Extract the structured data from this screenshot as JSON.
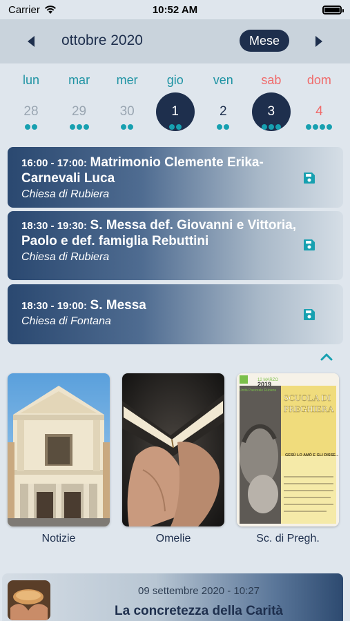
{
  "status_bar": {
    "carrier": "Carrier",
    "time": "10:52 AM",
    "battery_level": 1.0
  },
  "calendar": {
    "month_title": "ottobre 2020",
    "view_label": "Mese",
    "days": [
      {
        "name": "lun",
        "num": "28",
        "dots": 2,
        "state": "muted",
        "weekend": false
      },
      {
        "name": "mar",
        "num": "29",
        "dots": 3,
        "state": "muted",
        "weekend": false
      },
      {
        "name": "mer",
        "num": "30",
        "dots": 2,
        "state": "muted",
        "weekend": false
      },
      {
        "name": "gio",
        "num": "1",
        "dots": 2,
        "state": "selected",
        "weekend": false
      },
      {
        "name": "ven",
        "num": "2",
        "dots": 2,
        "state": "normal",
        "weekend": false
      },
      {
        "name": "sab",
        "num": "3",
        "dots": 3,
        "state": "selected",
        "weekend": true
      },
      {
        "name": "dom",
        "num": "4",
        "dots": 4,
        "state": "sunday",
        "weekend": true
      }
    ]
  },
  "events": [
    {
      "time": "16:00 - 17:00:",
      "title": "Matrimonio Clemente Erika-Carnevali Luca",
      "place": "Chiesa di Rubiera"
    },
    {
      "time": "18:30 - 19:30:",
      "title": "S. Messa def. Giovanni e Vittoria, Paolo e def. famiglia Rebuttini",
      "place": "Chiesa di Rubiera"
    },
    {
      "time": "18:30 - 19:00:",
      "title": "S. Messa",
      "place": "Chiesa di Fontana"
    }
  ],
  "tiles": [
    {
      "label": "Notizie"
    },
    {
      "label": "Omelie"
    },
    {
      "label": "Sc. di Pregh.",
      "poster": {
        "date_line": "12 MARZO",
        "year": "2019",
        "parish": "Unità Pastorale Rubiera",
        "title": "SCUOLA DI PREGHIERA",
        "quote": "GESÙ LO AMÒ E GLI DISSE..."
      }
    }
  ],
  "news": {
    "date": "09 settembre 2020 - 10:27",
    "title": "La concretezza della Carità"
  },
  "colors": {
    "navy": "#1e2f4d",
    "teal": "#17a0b0",
    "weekend": "#f06a6a",
    "background": "#dfe6ed"
  }
}
